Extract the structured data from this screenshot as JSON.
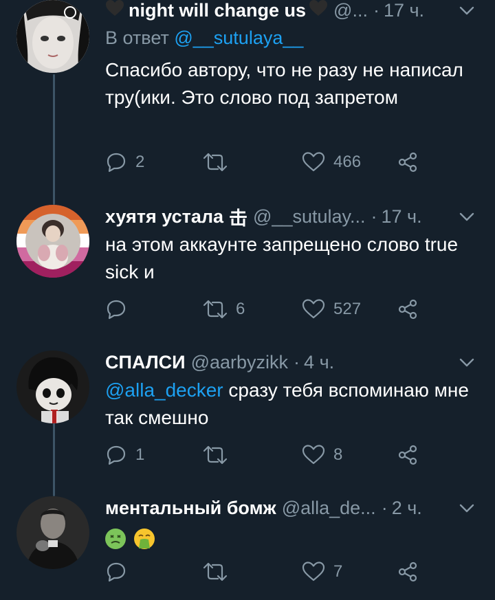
{
  "colors": {
    "background": "#15202b",
    "text": "#ffffff",
    "secondary": "#8899a6",
    "link": "#1da1f2",
    "thread_line": "#3d5466"
  },
  "tweets": [
    {
      "name": "night will change us",
      "handle": "@...",
      "time": "17 ч.",
      "reply_prefix": "В ответ",
      "reply_mention": "@__sutulaya__",
      "text": "Спасибо автору, что не разу не написал тру(ики. Это слово под запретом",
      "replies": "2",
      "retweets": "",
      "likes": "466"
    },
    {
      "name": "хуятя устала",
      "name_glyph": "击",
      "handle": "@__sutulay...",
      "time": "17 ч.",
      "text": "на этом аккаунте запрещено слово true sick и",
      "replies": "",
      "retweets": "6",
      "likes": "527"
    },
    {
      "name": "СПАЛСИ",
      "handle": "@aarbyzikk",
      "time": "4 ч.",
      "text_mention": "@alla_decker",
      "text": " сразу тебя вспоминаю мне так смешно",
      "replies": "1",
      "retweets": "",
      "likes": "8"
    },
    {
      "name": "ментальный бомж",
      "handle": "@alla_de...",
      "time": "2 ч.",
      "text": "",
      "emojis": [
        "nauseated-face",
        "vomiting-face"
      ],
      "replies": "",
      "retweets": "",
      "likes": "7"
    }
  ]
}
